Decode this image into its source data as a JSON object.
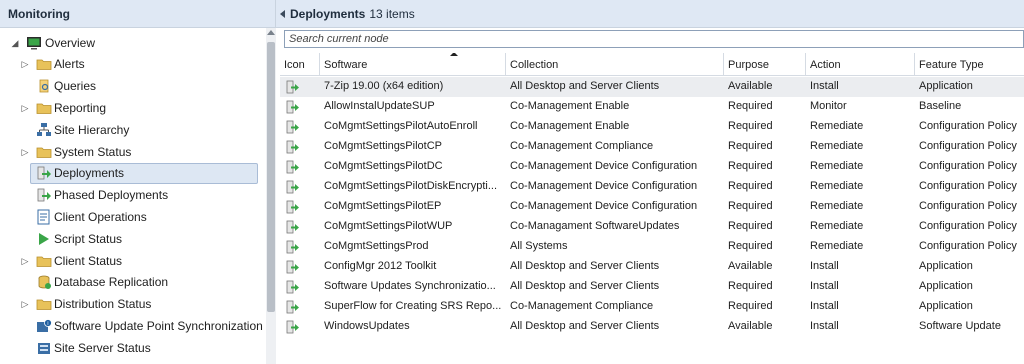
{
  "nav": {
    "header": "Monitoring",
    "items": [
      {
        "label": "Overview",
        "icon": "overview-icon",
        "expander": "open"
      },
      {
        "label": "Alerts",
        "icon": "folder-icon",
        "expander": "closed"
      },
      {
        "label": "Queries",
        "icon": "query-icon",
        "expander": "none"
      },
      {
        "label": "Reporting",
        "icon": "folder-icon",
        "expander": "closed"
      },
      {
        "label": "Site Hierarchy",
        "icon": "site-hierarchy-icon",
        "expander": "none"
      },
      {
        "label": "System Status",
        "icon": "folder-icon",
        "expander": "closed"
      },
      {
        "label": "Deployments",
        "icon": "deployment-icon",
        "expander": "none",
        "selected": true
      },
      {
        "label": "Phased Deployments",
        "icon": "phased-deployment-icon",
        "expander": "none"
      },
      {
        "label": "Client Operations",
        "icon": "client-operations-icon",
        "expander": "none"
      },
      {
        "label": "Script Status",
        "icon": "script-status-icon",
        "expander": "none"
      },
      {
        "label": "Client Status",
        "icon": "folder-icon",
        "expander": "closed"
      },
      {
        "label": "Database Replication",
        "icon": "database-icon",
        "expander": "none"
      },
      {
        "label": "Distribution Status",
        "icon": "folder-icon",
        "expander": "closed"
      },
      {
        "label": "Software Update Point Synchronization Sta",
        "icon": "sync-status-icon",
        "expander": "none"
      },
      {
        "label": "Site Server Status",
        "icon": "site-server-icon",
        "expander": "none"
      }
    ]
  },
  "main": {
    "title": "Deployments",
    "count": "13 items",
    "search_placeholder": "Search current node",
    "columns": [
      "Icon",
      "Software",
      "Collection",
      "Purpose",
      "Action",
      "Feature Type"
    ],
    "rows": [
      {
        "software": "7-Zip 19.00 (x64 edition)",
        "collection": "All Desktop and Server Clients",
        "purpose": "Available",
        "action": "Install",
        "feature": "Application",
        "selected": true
      },
      {
        "software": "AllowInstalUpdateSUP",
        "collection": "Co-Management Enable",
        "purpose": "Required",
        "action": "Monitor",
        "feature": "Baseline"
      },
      {
        "software": "CoMgmtSettingsPilotAutoEnroll",
        "collection": "Co-Management Enable",
        "purpose": "Required",
        "action": "Remediate",
        "feature": "Configuration Policy"
      },
      {
        "software": "CoMgmtSettingsPilotCP",
        "collection": "Co-Management Compliance",
        "purpose": "Required",
        "action": "Remediate",
        "feature": "Configuration Policy"
      },
      {
        "software": "CoMgmtSettingsPilotDC",
        "collection": "Co-Management Device Configuration",
        "purpose": "Required",
        "action": "Remediate",
        "feature": "Configuration Policy"
      },
      {
        "software": "CoMgmtSettingsPilotDiskEncrypti...",
        "collection": "Co-Management Device Configuration",
        "purpose": "Required",
        "action": "Remediate",
        "feature": "Configuration Policy"
      },
      {
        "software": "CoMgmtSettingsPilotEP",
        "collection": "Co-Management Device Configuration",
        "purpose": "Required",
        "action": "Remediate",
        "feature": "Configuration Policy"
      },
      {
        "software": "CoMgmtSettingsPilotWUP",
        "collection": "Co-Managament SoftwareUpdates",
        "purpose": "Required",
        "action": "Remediate",
        "feature": "Configuration Policy"
      },
      {
        "software": "CoMgmtSettingsProd",
        "collection": "All Systems",
        "purpose": "Required",
        "action": "Remediate",
        "feature": "Configuration Policy"
      },
      {
        "software": "ConfigMgr 2012 Toolkit",
        "collection": "All Desktop and Server Clients",
        "purpose": "Available",
        "action": "Install",
        "feature": "Application"
      },
      {
        "software": "Software Updates Synchronizatio...",
        "collection": "All Desktop and Server Clients",
        "purpose": "Required",
        "action": "Install",
        "feature": "Application"
      },
      {
        "software": "SuperFlow for Creating SRS Repo...",
        "collection": "Co-Management Compliance",
        "purpose": "Required",
        "action": "Install",
        "feature": "Application"
      },
      {
        "software": "WindowsUpdates",
        "collection": "All Desktop and Server Clients",
        "purpose": "Available",
        "action": "Install",
        "feature": "Software Update"
      }
    ]
  },
  "colors": {
    "header_bg": "#dfe8f4",
    "selection_bg": "#dde7f3",
    "icon_green": "#3aa548",
    "folder_yellow": "#e8c25a"
  }
}
